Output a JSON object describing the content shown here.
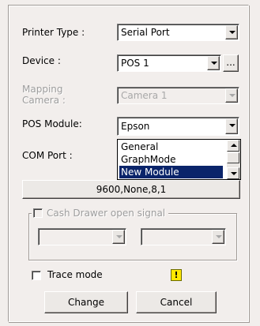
{
  "printer_type": {
    "label": "Printer Type :",
    "value": "Serial Port"
  },
  "device": {
    "label": "Device :",
    "value": "POS 1",
    "browse_label": "..."
  },
  "mapping_camera": {
    "label_line1": "Mapping",
    "label_line2": "Camera :",
    "value": "Camera 1"
  },
  "pos_module": {
    "label": "POS Module:",
    "value": "Epson",
    "options": [
      "General",
      "GraphMode",
      "New Module"
    ],
    "selected_option": "New Module"
  },
  "com_port": {
    "label": "COM Port :",
    "settings_value": "9600,None,8,1"
  },
  "cash_drawer": {
    "label": "Cash Drawer open signal",
    "checked": false,
    "enabled": false
  },
  "trace_mode": {
    "label": "Trace mode",
    "checked": false
  },
  "warning_icon": {
    "icon": "warning-icon",
    "glyph": "!"
  },
  "buttons": {
    "change": "Change",
    "cancel": "Cancel"
  }
}
